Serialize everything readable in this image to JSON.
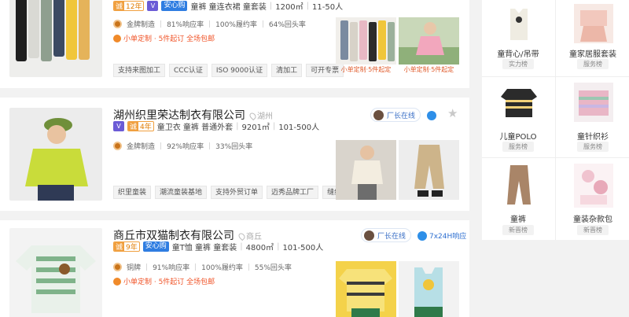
{
  "listings": [
    {
      "year_prefix": "诚",
      "years": "12年",
      "vip": "V",
      "assured": "安心购",
      "categories": "童裤 童连衣裙 童套装",
      "area": "1200㎡",
      "staff": "11-50人",
      "brand_label": "金牌制造",
      "response_rate": "81%响应率",
      "fulfillment_rate": "100%履约率",
      "repeat_rate": "64%回头率",
      "promo": "小单定制 · 5件起订 全场包邮",
      "chips": [
        "支持来图加工",
        "CCC认证",
        "ISO 9000认证",
        "清加工",
        "可开专票"
      ],
      "product_labels": [
        "小单定制·5件起定",
        "小单定制·5件起定"
      ]
    },
    {
      "name": "湖州织里荣达制衣有限公司",
      "location": "湖州",
      "year_prefix": "诚",
      "years": "4年",
      "vip": "V",
      "categories": "童卫衣 童裤 普通外套",
      "area": "9201㎡",
      "staff": "101-500人",
      "brand_label": "金牌制造",
      "response_rate": "92%响应率",
      "repeat_rate": "33%回头率",
      "online_label": "厂长在线",
      "chips": [
        "织里童装",
        "潮流童装基地",
        "支持外贸订单",
        "迈秀品牌工厂",
        "缝纫"
      ]
    },
    {
      "name": "商丘市双猫制衣有限公司",
      "location": "商丘",
      "year_prefix": "诚",
      "years": "9年",
      "assured": "安心购",
      "categories": "童T恤 童裤 童套装",
      "area": "4800㎡",
      "staff": "101-500人",
      "brand_label": "铜牌",
      "response_rate": "91%响应率",
      "fulfillment_rate": "100%履约率",
      "repeat_rate": "55%回头率",
      "promo": "小单定制 · 5件起订 全场包邮",
      "online_label": "厂长在线",
      "service_label": "7x24H响应"
    }
  ],
  "rank_panel": {
    "cells": [
      {
        "name": "童背心/吊带",
        "badge": "实力榜"
      },
      {
        "name": "童家居服套装",
        "badge": "服务榜"
      },
      {
        "name": "儿童POLO",
        "badge": "服务榜"
      },
      {
        "name": "童针织衫",
        "badge": "服务榜"
      },
      {
        "name": "童裤",
        "badge": "新晋榜"
      },
      {
        "name": "童装杂款包",
        "badge": "新晋榜"
      }
    ]
  },
  "colors": {
    "promo": "#f0552a",
    "accent_blue": "#2e8fe8",
    "vip": "#6b5bd6",
    "assured": "#2f7de1",
    "gold": "#f0a040"
  }
}
